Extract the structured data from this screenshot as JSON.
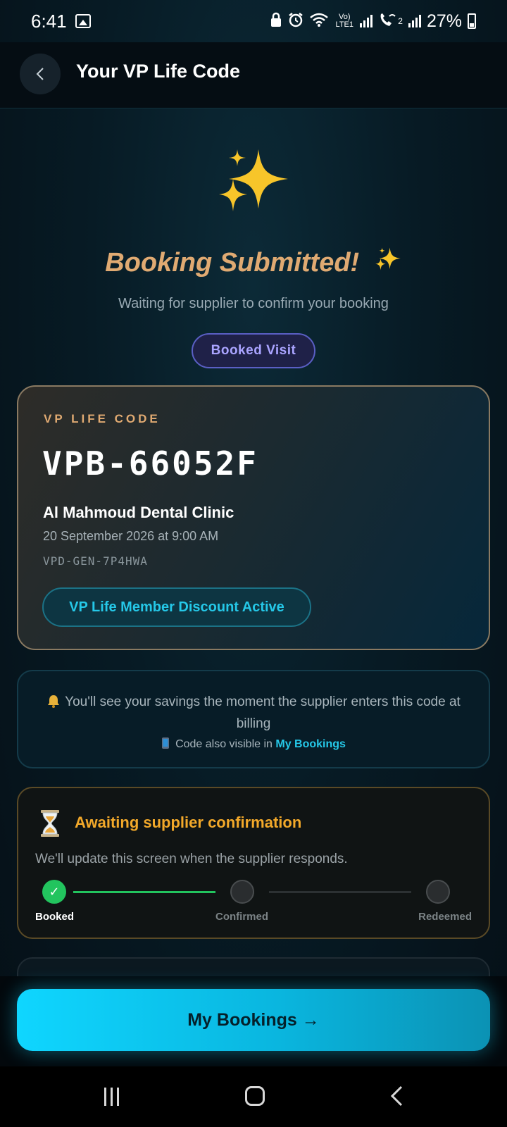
{
  "status_bar": {
    "time": "6:41",
    "network_label": "Vo) LTE1",
    "sim2_label": "2",
    "battery_percent": "27%"
  },
  "header": {
    "back_icon": "chevron-left-icon",
    "title": "Your VP Life Code"
  },
  "hero": {
    "icon": "sparkles-icon",
    "title": "Booking Submitted!",
    "title_emoji": "✨",
    "subtitle": "Waiting for supplier to confirm your booking",
    "status_pill": "Booked Visit"
  },
  "code_card": {
    "label": "VP LIFE CODE",
    "code": "VPB-66052F",
    "clinic": "Al Mahmoud Dental Clinic",
    "date": "20 September 2026 at 9:00 AM",
    "reference": "VPD-GEN-7P4HWA",
    "discount_badge": "VP Life Member Discount Active"
  },
  "info_box": {
    "icon": "bell-icon",
    "message": "You'll see your savings the moment the supplier enters this code at billing",
    "sub_icon": "phone-icon",
    "sub_prefix": "Code also visible in",
    "sub_link": "My Bookings"
  },
  "awaiting": {
    "icon": "hourglass-icon",
    "title": "Awaiting supplier confirmation",
    "message": "We'll update this screen when the supplier responds.",
    "steps": [
      {
        "label": "Booked",
        "state": "done"
      },
      {
        "label": "Confirmed",
        "state": "pending"
      },
      {
        "label": "Redeemed",
        "state": "pending"
      }
    ]
  },
  "primary_action": {
    "label": "My Bookings →"
  },
  "colors": {
    "accent": "#25c8e8",
    "gold": "#e0aa72",
    "warning": "#f3a92a",
    "success": "#22c45e",
    "indigo": "#aaa4ff"
  }
}
